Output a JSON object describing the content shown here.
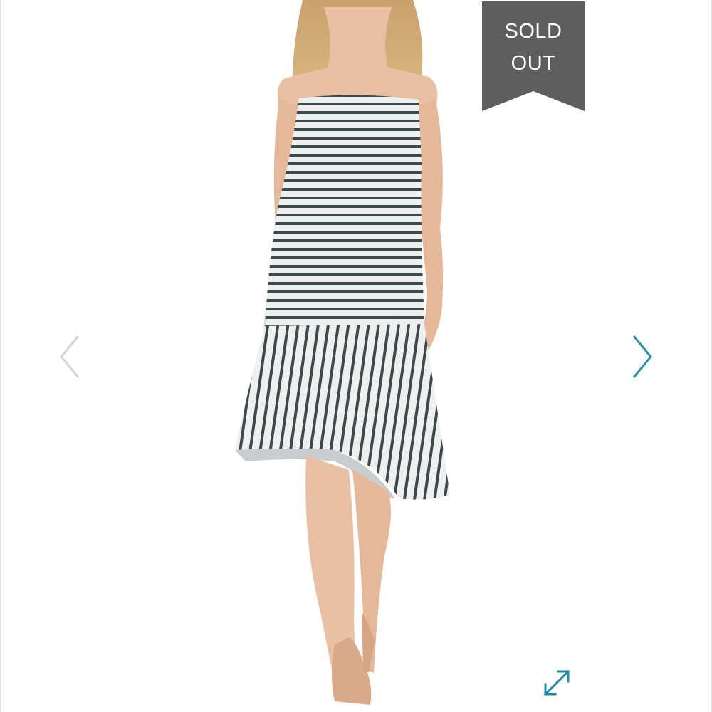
{
  "badge": {
    "line1": "SOLD",
    "line2": "OUT",
    "color": "#5e5e5e"
  },
  "product_image": {
    "description_icon": "striped-dress-photo"
  },
  "navigation": {
    "prev_icon": "chevron-left-icon",
    "next_icon": "chevron-right-icon",
    "prev_color": "#d5d5d5",
    "next_color": "#2a8fa8"
  },
  "expand": {
    "icon": "expand-icon",
    "color": "#1f8aa6"
  }
}
